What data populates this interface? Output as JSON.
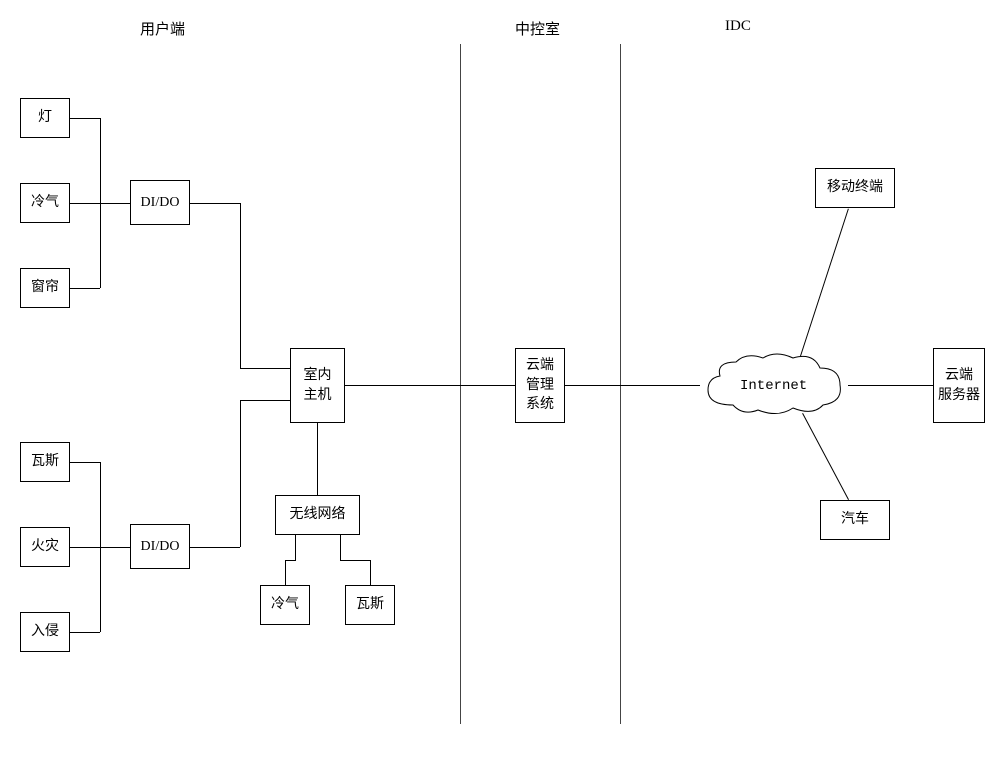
{
  "sections": {
    "client": "用户端",
    "control": "中控室",
    "idc": "IDC"
  },
  "boxes": {
    "light": "灯",
    "aircon1": "冷气",
    "curtain": "窗帘",
    "gas1": "瓦斯",
    "fire": "火灾",
    "intrusion": "入侵",
    "dido1": "DI/DO",
    "dido2": "DI/DO",
    "indoor_host": "室内\n主机",
    "wireless": "无线网络",
    "aircon2": "冷气",
    "gas2": "瓦斯",
    "cloud_mgmt": "云端\n管理\n系统",
    "mobile": "移动终端",
    "cloud_server": "云端\n服务器",
    "car": "汽车"
  },
  "cloud": {
    "internet": "Internet"
  }
}
